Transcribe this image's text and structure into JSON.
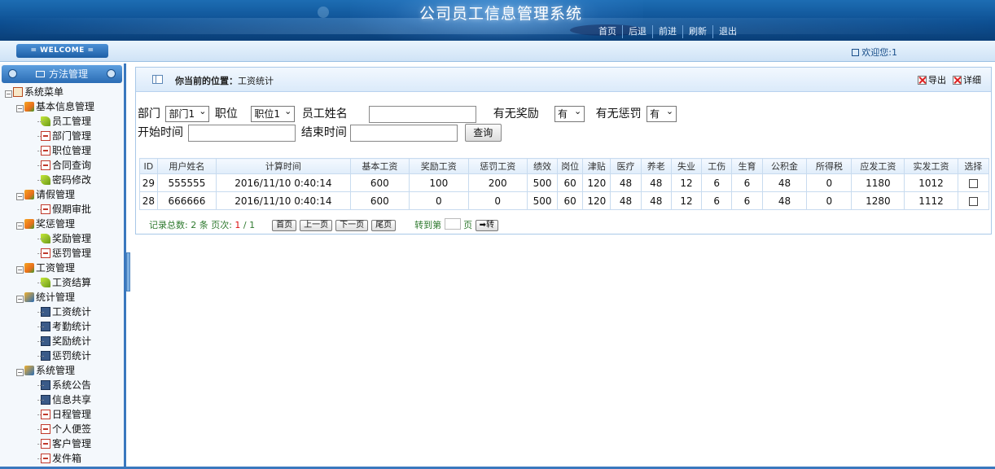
{
  "header": {
    "title": "公司员工信息管理系统",
    "nav": [
      "首页",
      "后退",
      "前进",
      "刷新",
      "退出"
    ]
  },
  "welcome": {
    "button": "= WELCOME =",
    "user": "欢迎您:1"
  },
  "sidebar": {
    "head": "方法管理",
    "root": "系统菜单",
    "groups": [
      {
        "label": "基本信息管理",
        "items": [
          "员工管理",
          "部门管理",
          "职位管理",
          "合同查询",
          "密码修改"
        ]
      },
      {
        "label": "请假管理",
        "items": [
          "假期审批"
        ]
      },
      {
        "label": "奖惩管理",
        "items": [
          "奖励管理",
          "惩罚管理"
        ]
      },
      {
        "label": "工资管理",
        "items": [
          "工资结算"
        ]
      },
      {
        "label": "统计管理",
        "items": [
          "工资统计",
          "考勤统计",
          "奖励统计",
          "惩罚统计"
        ]
      },
      {
        "label": "系统管理",
        "items": [
          "系统公告",
          "信息共享",
          "日程管理",
          "个人便签",
          "客户管理",
          "发件箱"
        ]
      }
    ]
  },
  "location": {
    "label": "你当前的位置：",
    "value": "工资统计",
    "actions": [
      "导出",
      "详细"
    ]
  },
  "search": {
    "dept_label": "部门",
    "dept_value": "部门1",
    "position_label": "职位",
    "position_value": "职位1",
    "name_label": "员工姓名",
    "name_value": "",
    "reward_label": "有无奖励",
    "reward_value": "有",
    "penalty_label": "有无惩罚",
    "penalty_value": "有",
    "start_label": "开始时间",
    "start_value": "",
    "end_label": "结束时间",
    "end_value": "",
    "query_button": "查询"
  },
  "table": {
    "columns": [
      "ID",
      "用户姓名",
      "计算时间",
      "基本工资",
      "奖励工资",
      "惩罚工资",
      "绩效",
      "岗位",
      "津贴",
      "医疗",
      "养老",
      "失业",
      "工伤",
      "生育",
      "公积金",
      "所得税",
      "应发工资",
      "实发工资",
      "选择"
    ],
    "rows": [
      [
        "29",
        "555555",
        "2016/11/10 0:40:14",
        "600",
        "100",
        "200",
        "500",
        "60",
        "120",
        "48",
        "48",
        "12",
        "6",
        "6",
        "48",
        "0",
        "1180",
        "1012"
      ],
      [
        "28",
        "666666",
        "2016/11/10 0:40:14",
        "600",
        "0",
        "0",
        "500",
        "60",
        "120",
        "48",
        "48",
        "12",
        "6",
        "6",
        "48",
        "0",
        "1280",
        "1112"
      ]
    ]
  },
  "pager": {
    "total_prefix": "记录总数: ",
    "total": "2",
    "total_suffix": " 条 页次: ",
    "current": "1",
    "sep": " / ",
    "pages": "1",
    "first": "首页",
    "prev": "上一页",
    "next": "下一页",
    "last": "尾页",
    "goto_label": "转到第",
    "goto_value": "",
    "page_suffix": "页",
    "goto_button": "➡转"
  }
}
